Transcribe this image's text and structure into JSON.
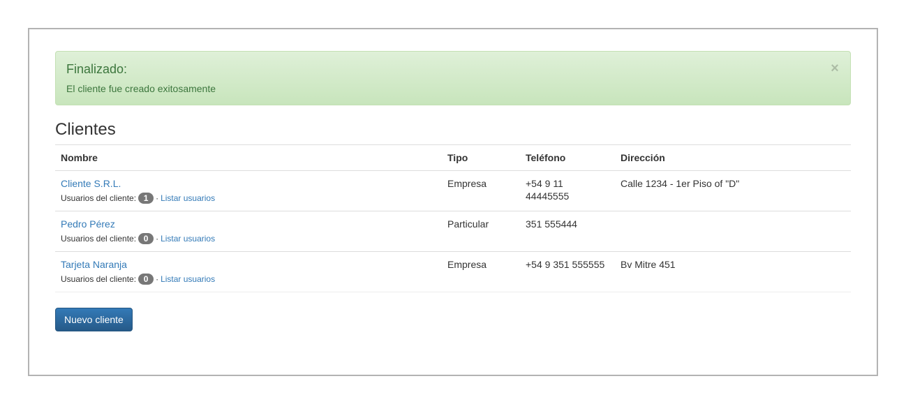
{
  "alert": {
    "title": "Finalizado:",
    "message": "El cliente fue creado exitosamente",
    "close": "×"
  },
  "page": {
    "title": "Clientes"
  },
  "table": {
    "headers": [
      "Nombre",
      "Tipo",
      "Teléfono",
      "Dirección"
    ],
    "rows": [
      {
        "nombre": "Cliente S.R.L.",
        "usuarios_label": "Usuarios del cliente:",
        "usuarios_count": "1",
        "separator": "·",
        "listar": "Listar usuarios",
        "tipo": "Empresa",
        "telefono": "+54 9 11 44445555",
        "direccion": "Calle 1234 - 1er Piso of \"D\""
      },
      {
        "nombre": "Pedro Pérez",
        "usuarios_label": "Usuarios del cliente:",
        "usuarios_count": "0",
        "separator": "·",
        "listar": "Listar usuarios",
        "tipo": "Particular",
        "telefono": "351 555444",
        "direccion": ""
      },
      {
        "nombre": "Tarjeta Naranja",
        "usuarios_label": "Usuarios del cliente:",
        "usuarios_count": "0",
        "separator": "·",
        "listar": "Listar usuarios",
        "tipo": "Empresa",
        "telefono": "+54 9 351 555555",
        "direccion": "Bv Mitre 451"
      }
    ]
  },
  "actions": {
    "new_client": "Nuevo cliente"
  },
  "colors": {
    "alert_text": "#3c763d",
    "alert_bg": "#dff0d8",
    "link": "#337ab7",
    "primary": "#337ab7",
    "badge": "#777777"
  }
}
